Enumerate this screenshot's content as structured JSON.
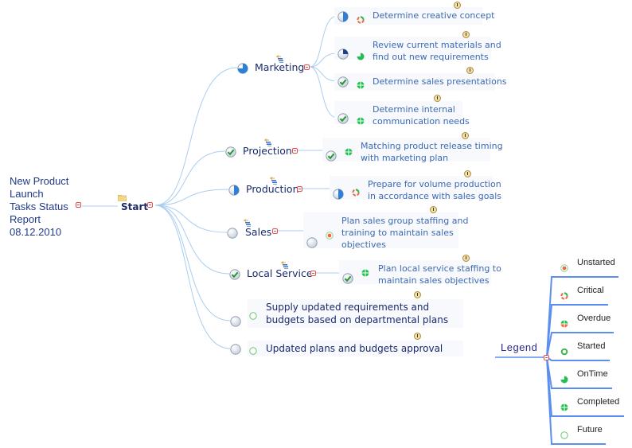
{
  "diagram": {
    "title_lines": [
      "New Product",
      "Launch",
      "Tasks Status",
      "Report",
      "08.12.2010"
    ],
    "root": {
      "label": "Start",
      "icon": "folder-icon"
    },
    "branches": [
      {
        "id": "marketing",
        "label": "Marketing",
        "progress": "three-quarters",
        "tasks": [
          {
            "text": [
              "Determine creative concept"
            ],
            "progress": "half",
            "status": "critical"
          },
          {
            "text": [
              "Review current materials and",
              "find out new requirements"
            ],
            "progress": "quarter",
            "status": "ontime"
          },
          {
            "text": [
              "Determine sales presentations"
            ],
            "progress": "complete",
            "status": "completed"
          },
          {
            "text": [
              "Determine internal",
              "communication needs"
            ],
            "progress": "complete",
            "status": "completed"
          }
        ]
      },
      {
        "id": "projection",
        "label": "Projection",
        "progress": "complete",
        "tasks": [
          {
            "text": [
              "Matching product release timing",
              "with marketing plan"
            ],
            "progress": "complete",
            "status": "completed"
          }
        ]
      },
      {
        "id": "production",
        "label": "Production",
        "progress": "half",
        "tasks": [
          {
            "text": [
              "Prepare for volume production",
              "in accordance with sales goals"
            ],
            "progress": "half",
            "status": "critical"
          }
        ]
      },
      {
        "id": "sales",
        "label": "Sales",
        "progress": "none",
        "tasks": [
          {
            "text": [
              "Plan sales group staffing and",
              "training to maintain sales",
              "objectives"
            ],
            "progress": "none",
            "status": "unstarted"
          }
        ]
      },
      {
        "id": "local-service",
        "label": "Local Service",
        "progress": "complete",
        "tasks": [
          {
            "text": [
              "Plan local service staffing to",
              "maintain sales objectives"
            ],
            "progress": "complete",
            "status": "completed"
          }
        ]
      }
    ],
    "leaf_tasks": [
      {
        "text": [
          "Supply updated requirements and",
          "budgets based on departmental plans"
        ],
        "progress": "none",
        "status": "future"
      },
      {
        "text": [
          "Updated plans and budgets approval"
        ],
        "progress": "none",
        "status": "future"
      }
    ]
  },
  "legend": {
    "title": "Legend",
    "items": [
      {
        "label": "Unstarted",
        "status": "unstarted"
      },
      {
        "label": "Critical",
        "status": "critical"
      },
      {
        "label": "Overdue",
        "status": "overdue"
      },
      {
        "label": "Started",
        "status": "started"
      },
      {
        "label": "OnTime",
        "status": "ontime"
      },
      {
        "label": "Completed",
        "status": "completed"
      },
      {
        "label": "Future",
        "status": "future"
      }
    ]
  },
  "colors": {
    "edge": "#a9cdf0",
    "legend_edge": "#5b8ef0",
    "status_red": "#f06a3c",
    "status_green": "#20c050",
    "future_green": "#6cc870",
    "task_text": "#3d6ab3",
    "node_text": "#1a2a6c"
  }
}
